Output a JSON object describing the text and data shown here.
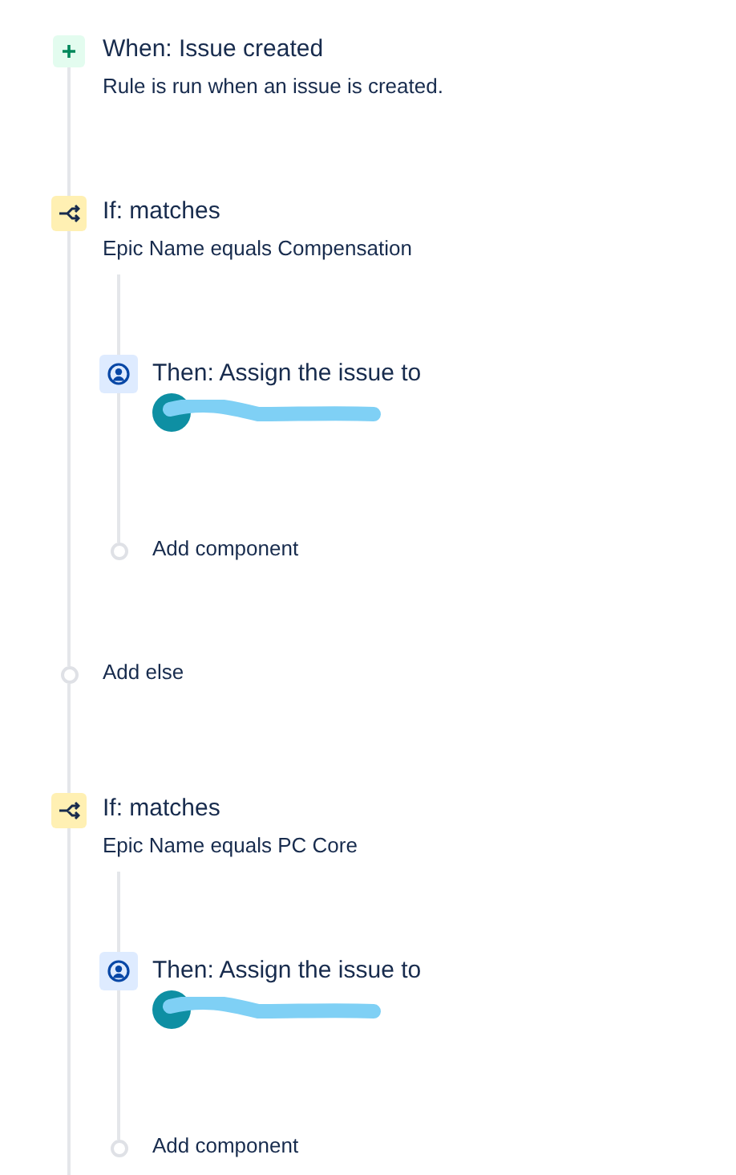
{
  "rule": [
    {
      "kind": "trigger",
      "title": "When: Issue created",
      "description": "Rule is run when an issue is created."
    },
    {
      "kind": "condition",
      "title": "If: matches",
      "description": "Epic Name equals Compensation",
      "steps": [
        {
          "kind": "action",
          "title": "Then: Assign the issue to"
        },
        {
          "kind": "add",
          "label": "Add component"
        }
      ]
    },
    {
      "kind": "add",
      "label": "Add else"
    },
    {
      "kind": "condition",
      "title": "If: matches",
      "description": "Epic Name equals PC Core",
      "steps": [
        {
          "kind": "action",
          "title": "Then: Assign the issue to"
        },
        {
          "kind": "add",
          "label": "Add component"
        }
      ]
    }
  ]
}
